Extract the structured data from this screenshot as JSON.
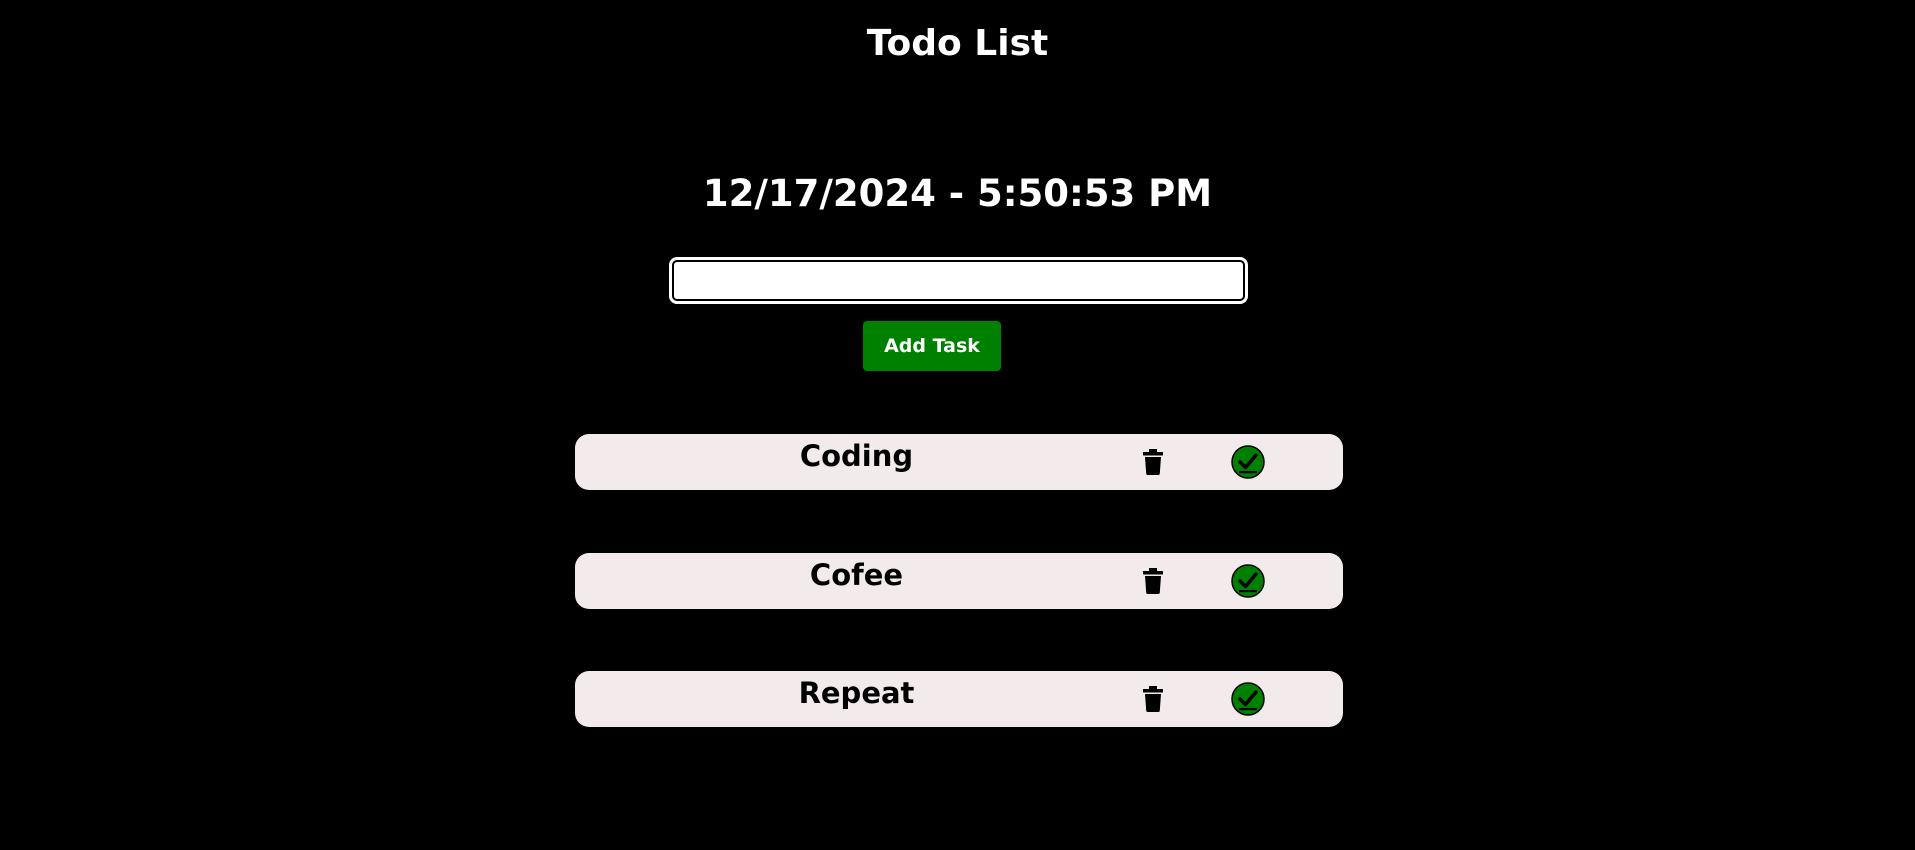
{
  "header": {
    "title": "Todo List"
  },
  "clock": {
    "datetime": "12/17/2024 - 5:50:53 PM"
  },
  "form": {
    "input_value": "",
    "add_button_label": "Add Task"
  },
  "tasks": [
    {
      "text": "Coding"
    },
    {
      "text": "Cofee"
    },
    {
      "text": "Repeat"
    }
  ],
  "icons": {
    "delete": "trash-icon",
    "complete": "check-circle-icon"
  },
  "colors": {
    "background": "#000000",
    "accent": "#008000",
    "task_background": "#f3ebeb"
  }
}
